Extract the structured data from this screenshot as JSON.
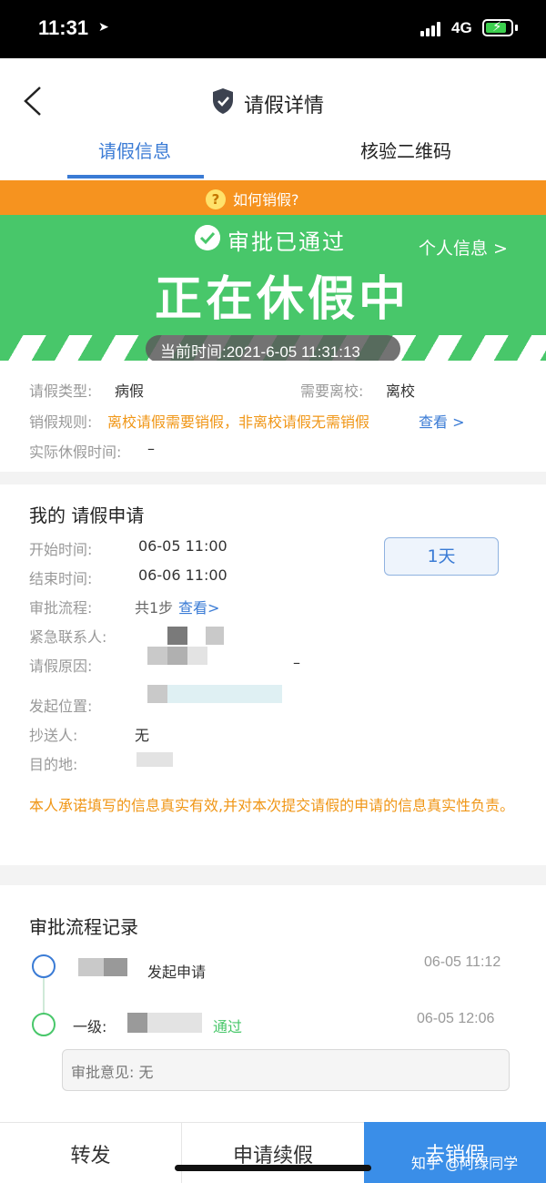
{
  "status_bar": {
    "time": "11:31",
    "network": "4G"
  },
  "nav": {
    "title": "请假详情"
  },
  "tabs": [
    {
      "label": "请假信息"
    },
    {
      "label": "核验二维码"
    }
  ],
  "help": {
    "text": "如何销假?"
  },
  "banner": {
    "approved_text": "审批已通过",
    "personal_info": "个人信息 >",
    "status": "正在休假中",
    "current_time": "当前时间:2021-6-05 11:31:13"
  },
  "leave_info": {
    "type_label": "请假类型:",
    "type_value": "病假",
    "need_leave_label": "需要离校:",
    "need_leave_value": "离校",
    "rule_label": "销假规则:",
    "rule_value": "离校请假需要销假，非离校请假无需销假",
    "rule_link": "查看 >",
    "actual_label": "实际休假时间:",
    "actual_value": "–"
  },
  "application": {
    "title": "我的 请假申请",
    "start_label": "开始时间:",
    "start_value": "06-05 11:00",
    "end_label": "结束时间:",
    "end_value": "06-06 11:00",
    "days": "1天",
    "process_label": "审批流程:",
    "process_value": "共1步",
    "process_link": "查看>",
    "contact_label": "紧急联系人:",
    "reason_label": "请假原因:",
    "reason_value": "–",
    "location_label": "发起位置:",
    "cc_label": "抄送人:",
    "cc_value": "无",
    "dest_label": "目的地:",
    "disclaimer": "本人承诺填写的信息真实有效,并对本次提交请假的申请的信息真实性负责。"
  },
  "records": {
    "title": "审批流程记录",
    "items": [
      {
        "action": "发起申请",
        "time": "06-05 11:12"
      },
      {
        "level": "一级:",
        "action": "通过",
        "time": "06-05 12:06"
      }
    ],
    "comment": "审批意见: 无"
  },
  "bottom": {
    "forward": "转发",
    "extend": "申请续假",
    "cancel": "去销假",
    "watermark": "知乎 @阿绿同学"
  },
  "colors": {
    "accent_blue": "#3a7bd5",
    "green": "#48c76a",
    "orange": "#f6931f"
  }
}
